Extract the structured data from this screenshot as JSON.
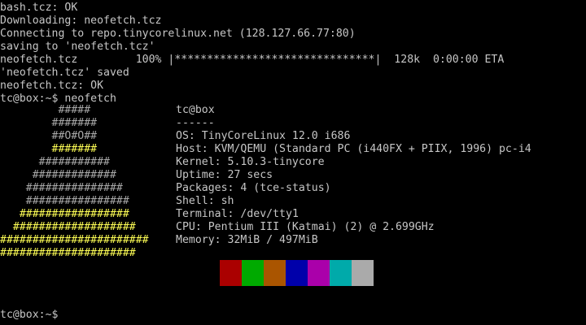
{
  "terminal": {
    "lines": [
      "bash.tcz: OK",
      "Downloading: neofetch.tcz",
      "Connecting to repo.tinycorelinux.net (128.127.66.77:80)",
      "saving to 'neofetch.tcz'",
      "neofetch.tcz         100% |*******************************|  128k  0:00:00 ETA",
      "'neofetch.tcz' saved",
      "neofetch.tcz: OK",
      "tc@box:~$ neofetch"
    ],
    "final_prompt": "tc@box:~$ "
  },
  "logo": {
    "rows": [
      "         #####",
      "        #######",
      "        ##O#O##",
      "        #######",
      "      ###########",
      "     #############",
      "    ###############",
      "    ################",
      "   #################",
      "  ###################",
      "#######################",
      "#####################"
    ],
    "accent_color": "#ffff55"
  },
  "info": {
    "title": "tc@box",
    "separator": "------",
    "fields": [
      {
        "key": "OS",
        "value": "TinyCoreLinux 12.0 i686"
      },
      {
        "key": "Host",
        "value": "KVM/QEMU (Standard PC (i440FX + PIIX, 1996) pc-i4"
      },
      {
        "key": "Kernel",
        "value": "5.10.3-tinycore"
      },
      {
        "key": "Uptime",
        "value": "27 secs"
      },
      {
        "key": "Packages",
        "value": "4 (tce-status)"
      },
      {
        "key": "Shell",
        "value": "sh"
      },
      {
        "key": "Terminal",
        "value": "/dev/tty1"
      },
      {
        "key": "CPU",
        "value": "Pentium III (Katmai) (2) @ 2.699GHz"
      },
      {
        "key": "Memory",
        "value": "32MiB / 497MiB"
      }
    ]
  },
  "palette": {
    "colors": [
      "#000000",
      "#aa0000",
      "#00aa00",
      "#aa5500",
      "#0000aa",
      "#aa00aa",
      "#00aaaa",
      "#aaaaaa"
    ]
  }
}
